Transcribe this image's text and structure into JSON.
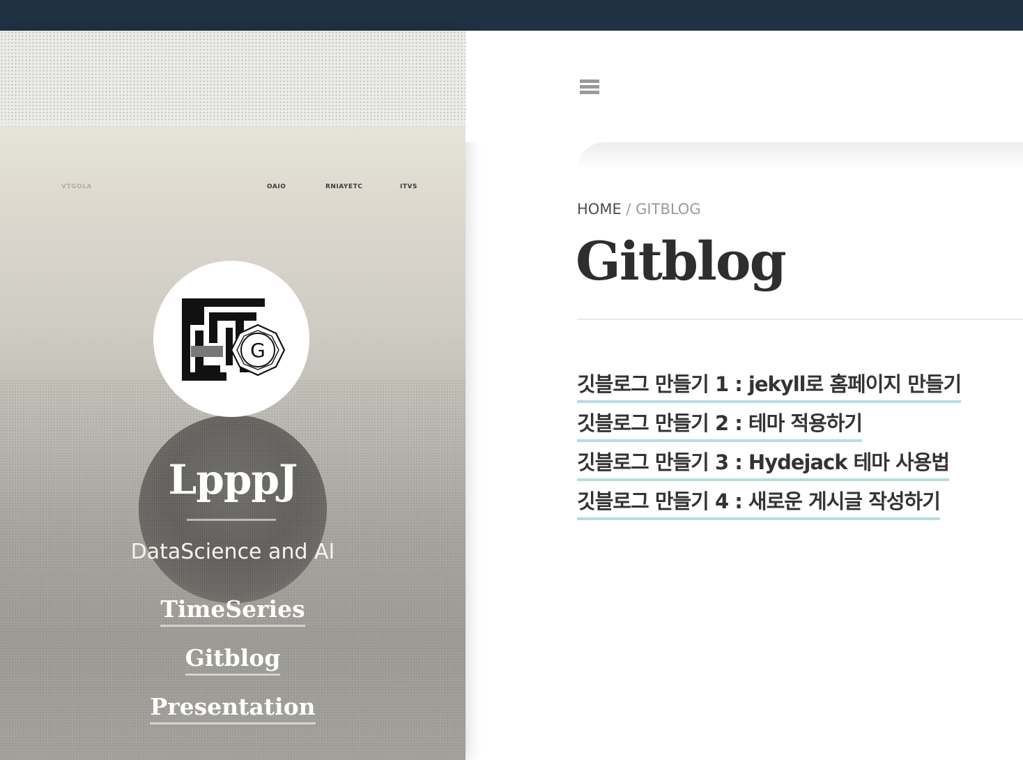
{
  "sidebar": {
    "background_label_1": "OAIO",
    "background_label_2": "RNIAYETC",
    "background_label_3": "ITVS",
    "background_label_faint": "VTGOLA",
    "site_title": "LpppJ",
    "tagline": "DataScience and AI",
    "nav": [
      {
        "label": "TimeSeries"
      },
      {
        "label": "Gitblog"
      },
      {
        "label": "Presentation"
      }
    ],
    "avatar_letter": "G"
  },
  "main": {
    "breadcrumb": {
      "home": "HOME",
      "separator": " / ",
      "current": "GITBLOG"
    },
    "title": "Gitblog",
    "posts": [
      {
        "title": "깃블로그 만들기 1 : jekyll로 홈페이지 만들기"
      },
      {
        "title": "깃블로그 만들기 2 : 테마 적용하기"
      },
      {
        "title": "깃블로그 만들기 3 : Hydejack 테마 사용법"
      },
      {
        "title": "깃블로그 만들기 4 : 새로운 게시글 작성하기"
      }
    ]
  },
  "colors": {
    "topbar": "#1f3142",
    "link_underline": "#b7dcdf",
    "heading": "#2e2e2e"
  },
  "icons": {
    "menu": "hamburger-menu-icon",
    "logo": "blog-logo-icon"
  }
}
